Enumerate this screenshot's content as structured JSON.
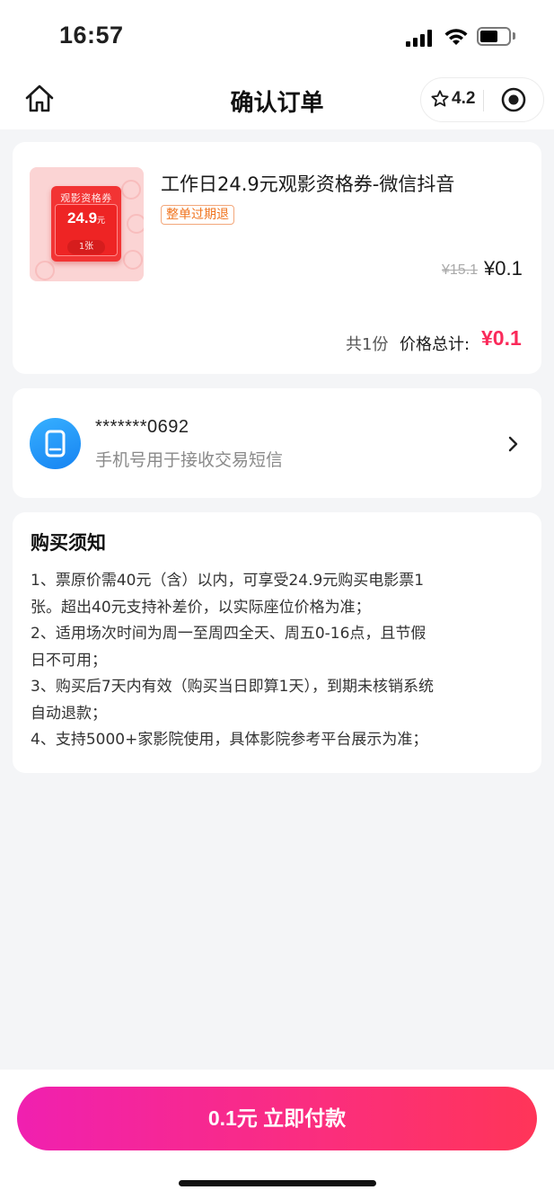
{
  "status_bar": {
    "time": "16:57"
  },
  "nav": {
    "title": "确认订单",
    "rating": "4.2"
  },
  "product": {
    "thumbnail": {
      "title": "观影资格券",
      "amount": "24.9",
      "unit": "元",
      "count": "1张"
    },
    "name": "工作日24.9元观影资格券-微信抖音",
    "tag": "整单过期退",
    "original_price": "¥15.1",
    "price": "¥0.1",
    "quantity_text": "共1份",
    "total_label": "价格总计:",
    "total_price": "¥0.1"
  },
  "phone": {
    "number": "*******0692",
    "hint": "手机号用于接收交易短信"
  },
  "notice": {
    "title": "购买须知",
    "lines": [
      "1、票原价需40元（含）以内，可享受24.9元购买电影票1",
      "张。超出40元支持补差价，以实际座位价格为准；",
      "2、适用场次时间为周一至周四全天、周五0-16点，且节假",
      "日不可用；",
      "3、购买后7天内有效（购买当日即算1天），到期未核销系统",
      "自动退款；",
      "4、支持5000+家影院使用，具体影院参考平台展示为准；"
    ]
  },
  "pay_button": {
    "label": "0.1元 立即付款"
  },
  "colors": {
    "accent": "#fa2a5a",
    "button_start": "#f020b0",
    "button_end": "#ff3558",
    "phone_icon": "#1683f2"
  },
  "icons": [
    "home-icon",
    "star-icon",
    "target-icon",
    "ticket-icon",
    "phone-icon",
    "chevron-right-icon"
  ]
}
